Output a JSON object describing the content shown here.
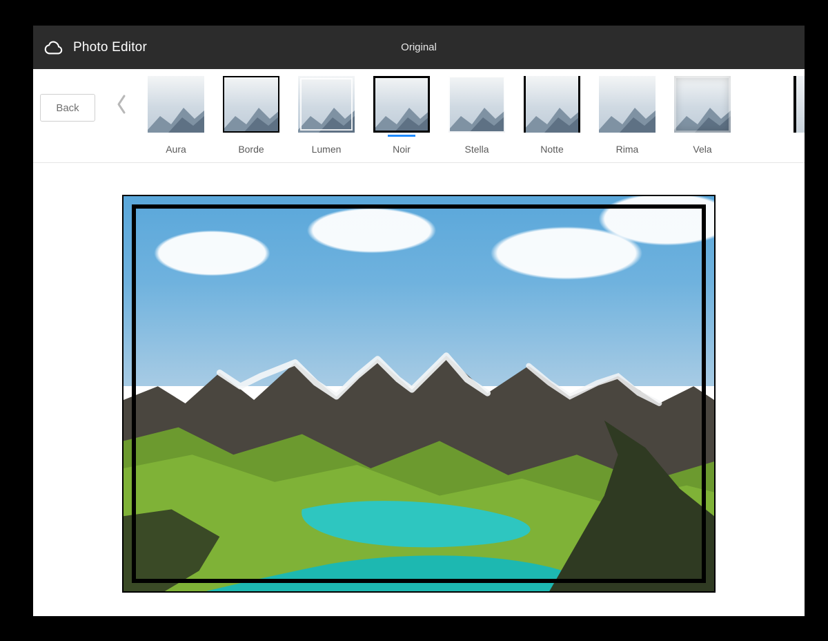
{
  "header": {
    "app_title": "Photo Editor",
    "original_tab": "Original"
  },
  "strip": {
    "back_label": "Back",
    "selected_index": 3,
    "items": [
      {
        "label": "Aura",
        "style": "aura"
      },
      {
        "label": "Borde",
        "style": "borde"
      },
      {
        "label": "Lumen",
        "style": "lumen"
      },
      {
        "label": "Noir",
        "style": "noir"
      },
      {
        "label": "Stella",
        "style": "stella"
      },
      {
        "label": "Notte",
        "style": "notte"
      },
      {
        "label": "Rima",
        "style": "rima"
      },
      {
        "label": "Vela",
        "style": "vela"
      }
    ]
  },
  "canvas": {
    "applied_frame": "Borde"
  },
  "colors": {
    "accent": "#1e8bff",
    "header_bg": "#2c2c2c"
  }
}
